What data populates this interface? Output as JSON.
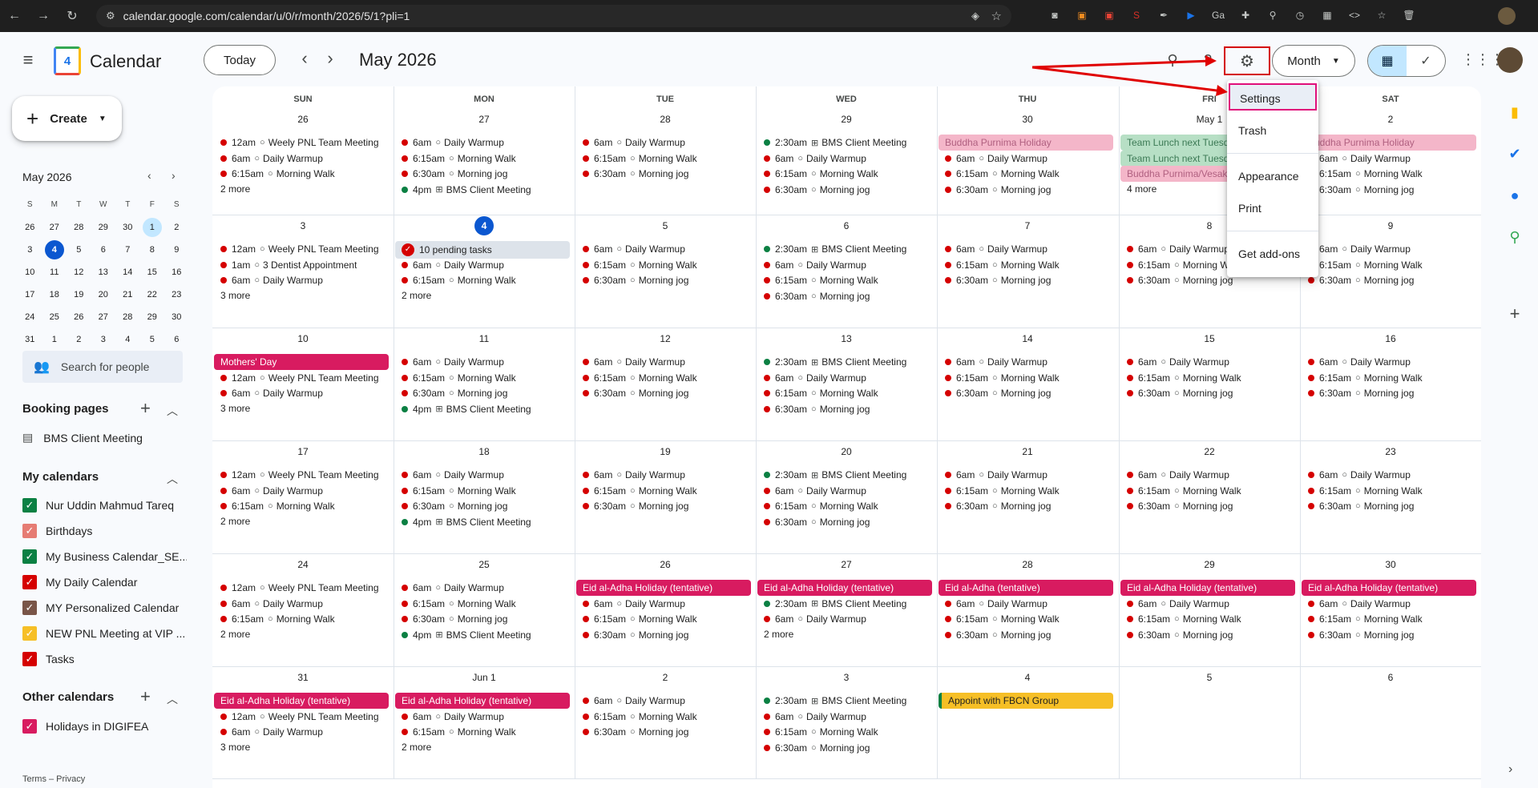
{
  "browser": {
    "url": "calendar.google.com/calendar/u/0/r/month/2026/5/1?pli=1"
  },
  "header": {
    "app_name": "Calendar",
    "logo_number": "4",
    "today_label": "Today",
    "month_title": "May 2026",
    "view_label": "Month"
  },
  "sidebar": {
    "create_label": "Create",
    "mini_month": "May 2026",
    "dow": [
      "S",
      "M",
      "T",
      "W",
      "T",
      "F",
      "S"
    ],
    "days": [
      "26",
      "27",
      "28",
      "29",
      "30",
      "1",
      "2",
      "3",
      "4",
      "5",
      "6",
      "7",
      "8",
      "9",
      "10",
      "11",
      "12",
      "13",
      "14",
      "15",
      "16",
      "17",
      "18",
      "19",
      "20",
      "21",
      "22",
      "23",
      "24",
      "25",
      "26",
      "27",
      "28",
      "29",
      "30",
      "31",
      "1",
      "2",
      "3",
      "4",
      "5",
      "6"
    ],
    "search_people": "Search for people",
    "booking_pages": "Booking pages",
    "booking_item": "BMS Client Meeting",
    "my_calendars": "My calendars",
    "my_calendar_items": [
      {
        "label": "Nur Uddin Mahmud Tareq",
        "color": "#0b8043"
      },
      {
        "label": "Birthdays",
        "color": "#e67c73"
      },
      {
        "label": "My Business Calendar_SE...",
        "color": "#0b8043"
      },
      {
        "label": "My Daily Calendar",
        "color": "#d50000"
      },
      {
        "label": "MY Personalized Calendar",
        "color": "#795548"
      },
      {
        "label": "NEW PNL Meeting at VIP ...",
        "color": "#f6bf26"
      },
      {
        "label": "Tasks",
        "color": "#d50000"
      }
    ],
    "other_calendars": "Other calendars",
    "other_calendar_items": [
      {
        "label": "Holidays in DIGIFEA",
        "color": "#d81b60"
      }
    ],
    "terms": "Terms – Privacy"
  },
  "grid": {
    "dow": [
      "SUN",
      "MON",
      "TUE",
      "WED",
      "THU",
      "FRI",
      "SAT"
    ],
    "day_numbers": [
      [
        "26",
        "27",
        "28",
        "29",
        "30",
        "May 1",
        "2"
      ],
      [
        "3",
        "4",
        "5",
        "6",
        "7",
        "8",
        "9"
      ],
      [
        "10",
        "11",
        "12",
        "13",
        "14",
        "15",
        "16"
      ],
      [
        "17",
        "18",
        "19",
        "20",
        "21",
        "22",
        "23"
      ],
      [
        "24",
        "25",
        "26",
        "27",
        "28",
        "29",
        "30"
      ],
      [
        "31",
        "Jun 1",
        "2",
        "3",
        "4",
        "5",
        "6"
      ]
    ],
    "events": {
      "weekly_pnl": "Weely PNL Team Meeting",
      "daily_warmup": "Daily Warmup",
      "morning_walk": "Morning Walk",
      "morning_jog": "Morning jog",
      "bms": "BMS Client Meeting",
      "dentist": "3 Dentist Appointment",
      "pending": "10 pending tasks",
      "buddha": "Buddha Purnima Holiday",
      "team_lunch": "Team Lunch next Tuesd",
      "buddha_vesak": "Buddha Purnima/Vesak",
      "mothers_day": "Mothers' Day",
      "eid_tentative_holiday": "Eid al-Adha Holiday (tentative)",
      "eid_tentative": "Eid al-Adha (tentative)",
      "fbcn": "Appoint with FBCN Group"
    },
    "times": {
      "t12am": "12am",
      "t1am": "1am",
      "t6am": "6am",
      "t615": "6:15am",
      "t630": "6:30am",
      "t230": "2:30am",
      "t4pm": "4pm"
    },
    "more": {
      "m2": "2 more",
      "m3": "3 more",
      "m4": "4 more"
    }
  },
  "settings_menu": {
    "settings": "Settings",
    "trash": "Trash",
    "appearance": "Appearance",
    "print": "Print",
    "addons": "Get add-ons"
  },
  "colors": {
    "red_dot": "#d50000",
    "green_dot": "#0b8043",
    "holiday": "#d81b60",
    "holiday_light": "#f4b6c9",
    "team_lunch": "#b7dfc5",
    "fbcn": "#f6bf26",
    "today": "#0b57d0",
    "annotation": "#e00000"
  }
}
